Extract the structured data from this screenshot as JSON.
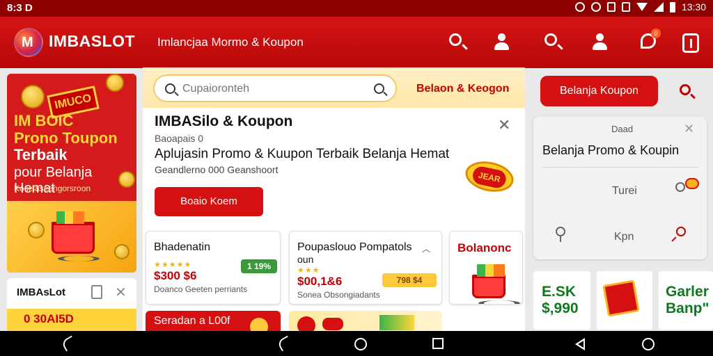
{
  "status_bar": {
    "time_left": "8:3 D",
    "time_right": "13:30"
  },
  "app_bar": {
    "brand": "IMBASLOT",
    "title": "Imlancjaa Mormo & Koupon",
    "notification_badge": "0"
  },
  "promo_banner": {
    "stamp": "IMUCO",
    "headline_top": "IM BOIC",
    "headline_1": "Prono Toupon",
    "headline_2": "Terbaik",
    "subline": "pour Belanja Hemat",
    "footnote": "Koolsaseengorsroon"
  },
  "mini_card": {
    "name": "IMBAsLot",
    "amount": "0 30AI5D"
  },
  "search": {
    "placeholder": "Cupaioronteh",
    "side_link": "Belaon & Keogon"
  },
  "hero": {
    "title": "IMBASilo & Koupon",
    "subtitle": "Baoapais 0",
    "tagline": "Aplujasin Promo & Kuupon Terbaik Belanja Hemat",
    "caption": "Geandlerno 000 Geanshoort",
    "button": "Boaio Koem",
    "tag": "JEAR"
  },
  "products": [
    {
      "name": "Bhadenatin",
      "price": "$300 $6",
      "sold": "Doanco Geeten perriants",
      "pill": "1 19%",
      "stars": "★★★★★"
    },
    {
      "name": "Poupaslouo Pompatols",
      "name2": "oun",
      "price": "$00,1&6",
      "sold": "Sonea Obsongiadants",
      "pill": "798 $4",
      "stars": "★★★"
    },
    {
      "name": "Bolanonc"
    }
  ],
  "bottom_strip": {
    "label": "Seradan a L00f"
  },
  "right_panel": {
    "button": "Belanja Koupon",
    "panel_title": "Daad",
    "heading": "Belanja Promo & Koupin",
    "item_1": "Turei",
    "item_2": "Kpn"
  },
  "right_tiles": [
    {
      "line1": "E.SK",
      "line2": "$,990"
    },
    {
      "line1": "Garler",
      "line2": "Banp\""
    }
  ],
  "colors": {
    "primary": "#d41010",
    "accent": "#ffd43b",
    "price": "#c40000",
    "success": "#0d7a1f"
  }
}
